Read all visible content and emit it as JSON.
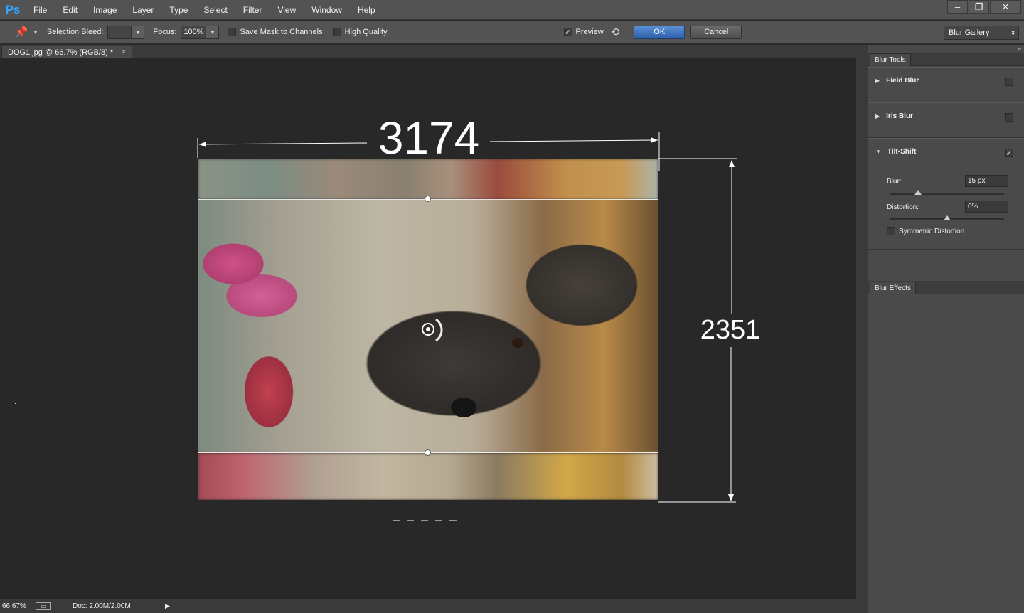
{
  "app": {
    "logo": "Ps"
  },
  "menu": [
    "File",
    "Edit",
    "Image",
    "Layer",
    "Type",
    "Select",
    "Filter",
    "View",
    "Window",
    "Help"
  ],
  "window_controls": {
    "minimize": "–",
    "restore": "❐",
    "close": "✕"
  },
  "options_bar": {
    "tool_icon": "pin-icon",
    "selection_bleed_label": "Selection Bleed:",
    "selection_bleed_value": "",
    "focus_label": "Focus:",
    "focus_value": "100%",
    "save_mask_label": "Save Mask to Channels",
    "save_mask_checked": false,
    "high_quality_label": "High Quality",
    "high_quality_checked": false,
    "preview_label": "Preview",
    "preview_checked": true,
    "ok_label": "OK",
    "cancel_label": "Cancel",
    "workspace_value": "Blur Gallery"
  },
  "document": {
    "tab_title": "DOG1.jpg @ 66.7% (RGB/8) *",
    "tab_close": "×"
  },
  "annotations": {
    "width_label": "3174",
    "height_label": "2351"
  },
  "status": {
    "zoom": "66.67%",
    "doc_info": "Doc: 2.00M/2.00M",
    "arrow": "▶"
  },
  "panel": {
    "collapse": "»",
    "blur_tools_tab": "Blur Tools",
    "blur_effects_tab": "Blur Effects",
    "sections": [
      {
        "name": "Field Blur",
        "expanded": false,
        "enabled": false
      },
      {
        "name": "Iris Blur",
        "expanded": false,
        "enabled": false
      },
      {
        "name": "Tilt-Shift",
        "expanded": true,
        "enabled": true
      }
    ],
    "tilt_shift": {
      "blur_label": "Blur:",
      "blur_value": "15 px",
      "blur_level": 0.24,
      "distortion_label": "Distortion:",
      "distortion_value": "0%",
      "distortion_level": 0.5,
      "symmetric_label": "Symmetric Distortion",
      "symmetric_checked": false
    }
  },
  "colors": {
    "accent": "#31a8ff",
    "ok_button": "#3a6cbc",
    "canvas_bg": "#282828",
    "panel_bg": "#4a4a4a"
  }
}
